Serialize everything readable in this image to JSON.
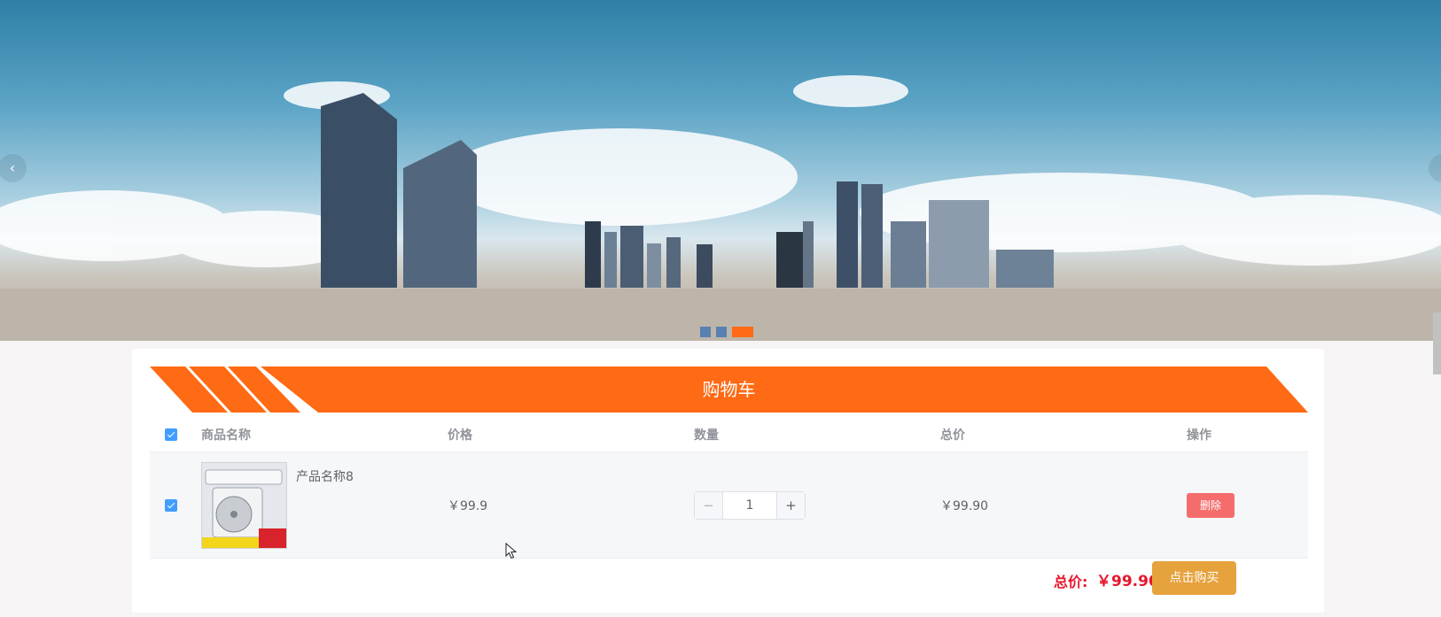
{
  "banner": {
    "prev_arrow": "‹",
    "next_arrow": "›",
    "slides": 3,
    "active_slide": 3
  },
  "cart": {
    "title": "购物车",
    "columns": {
      "name": "商品名称",
      "price": "价格",
      "qty": "数量",
      "total": "总价",
      "op": "操作"
    },
    "items": [
      {
        "name": "产品名称8",
        "price": "￥99.9",
        "qty": "1",
        "total": "￥99.90",
        "delete_label": "删除",
        "checked": true
      }
    ],
    "summary_label": "总价:",
    "summary_value": "￥99.90",
    "buy_label": "点击购买",
    "minus": "−",
    "plus": "+"
  },
  "colors": {
    "accent": "#ff6a14",
    "checkbox": "#409eff",
    "delete": "#f56c6c",
    "buy": "#e6a23c",
    "price_red": "#e6162d"
  }
}
